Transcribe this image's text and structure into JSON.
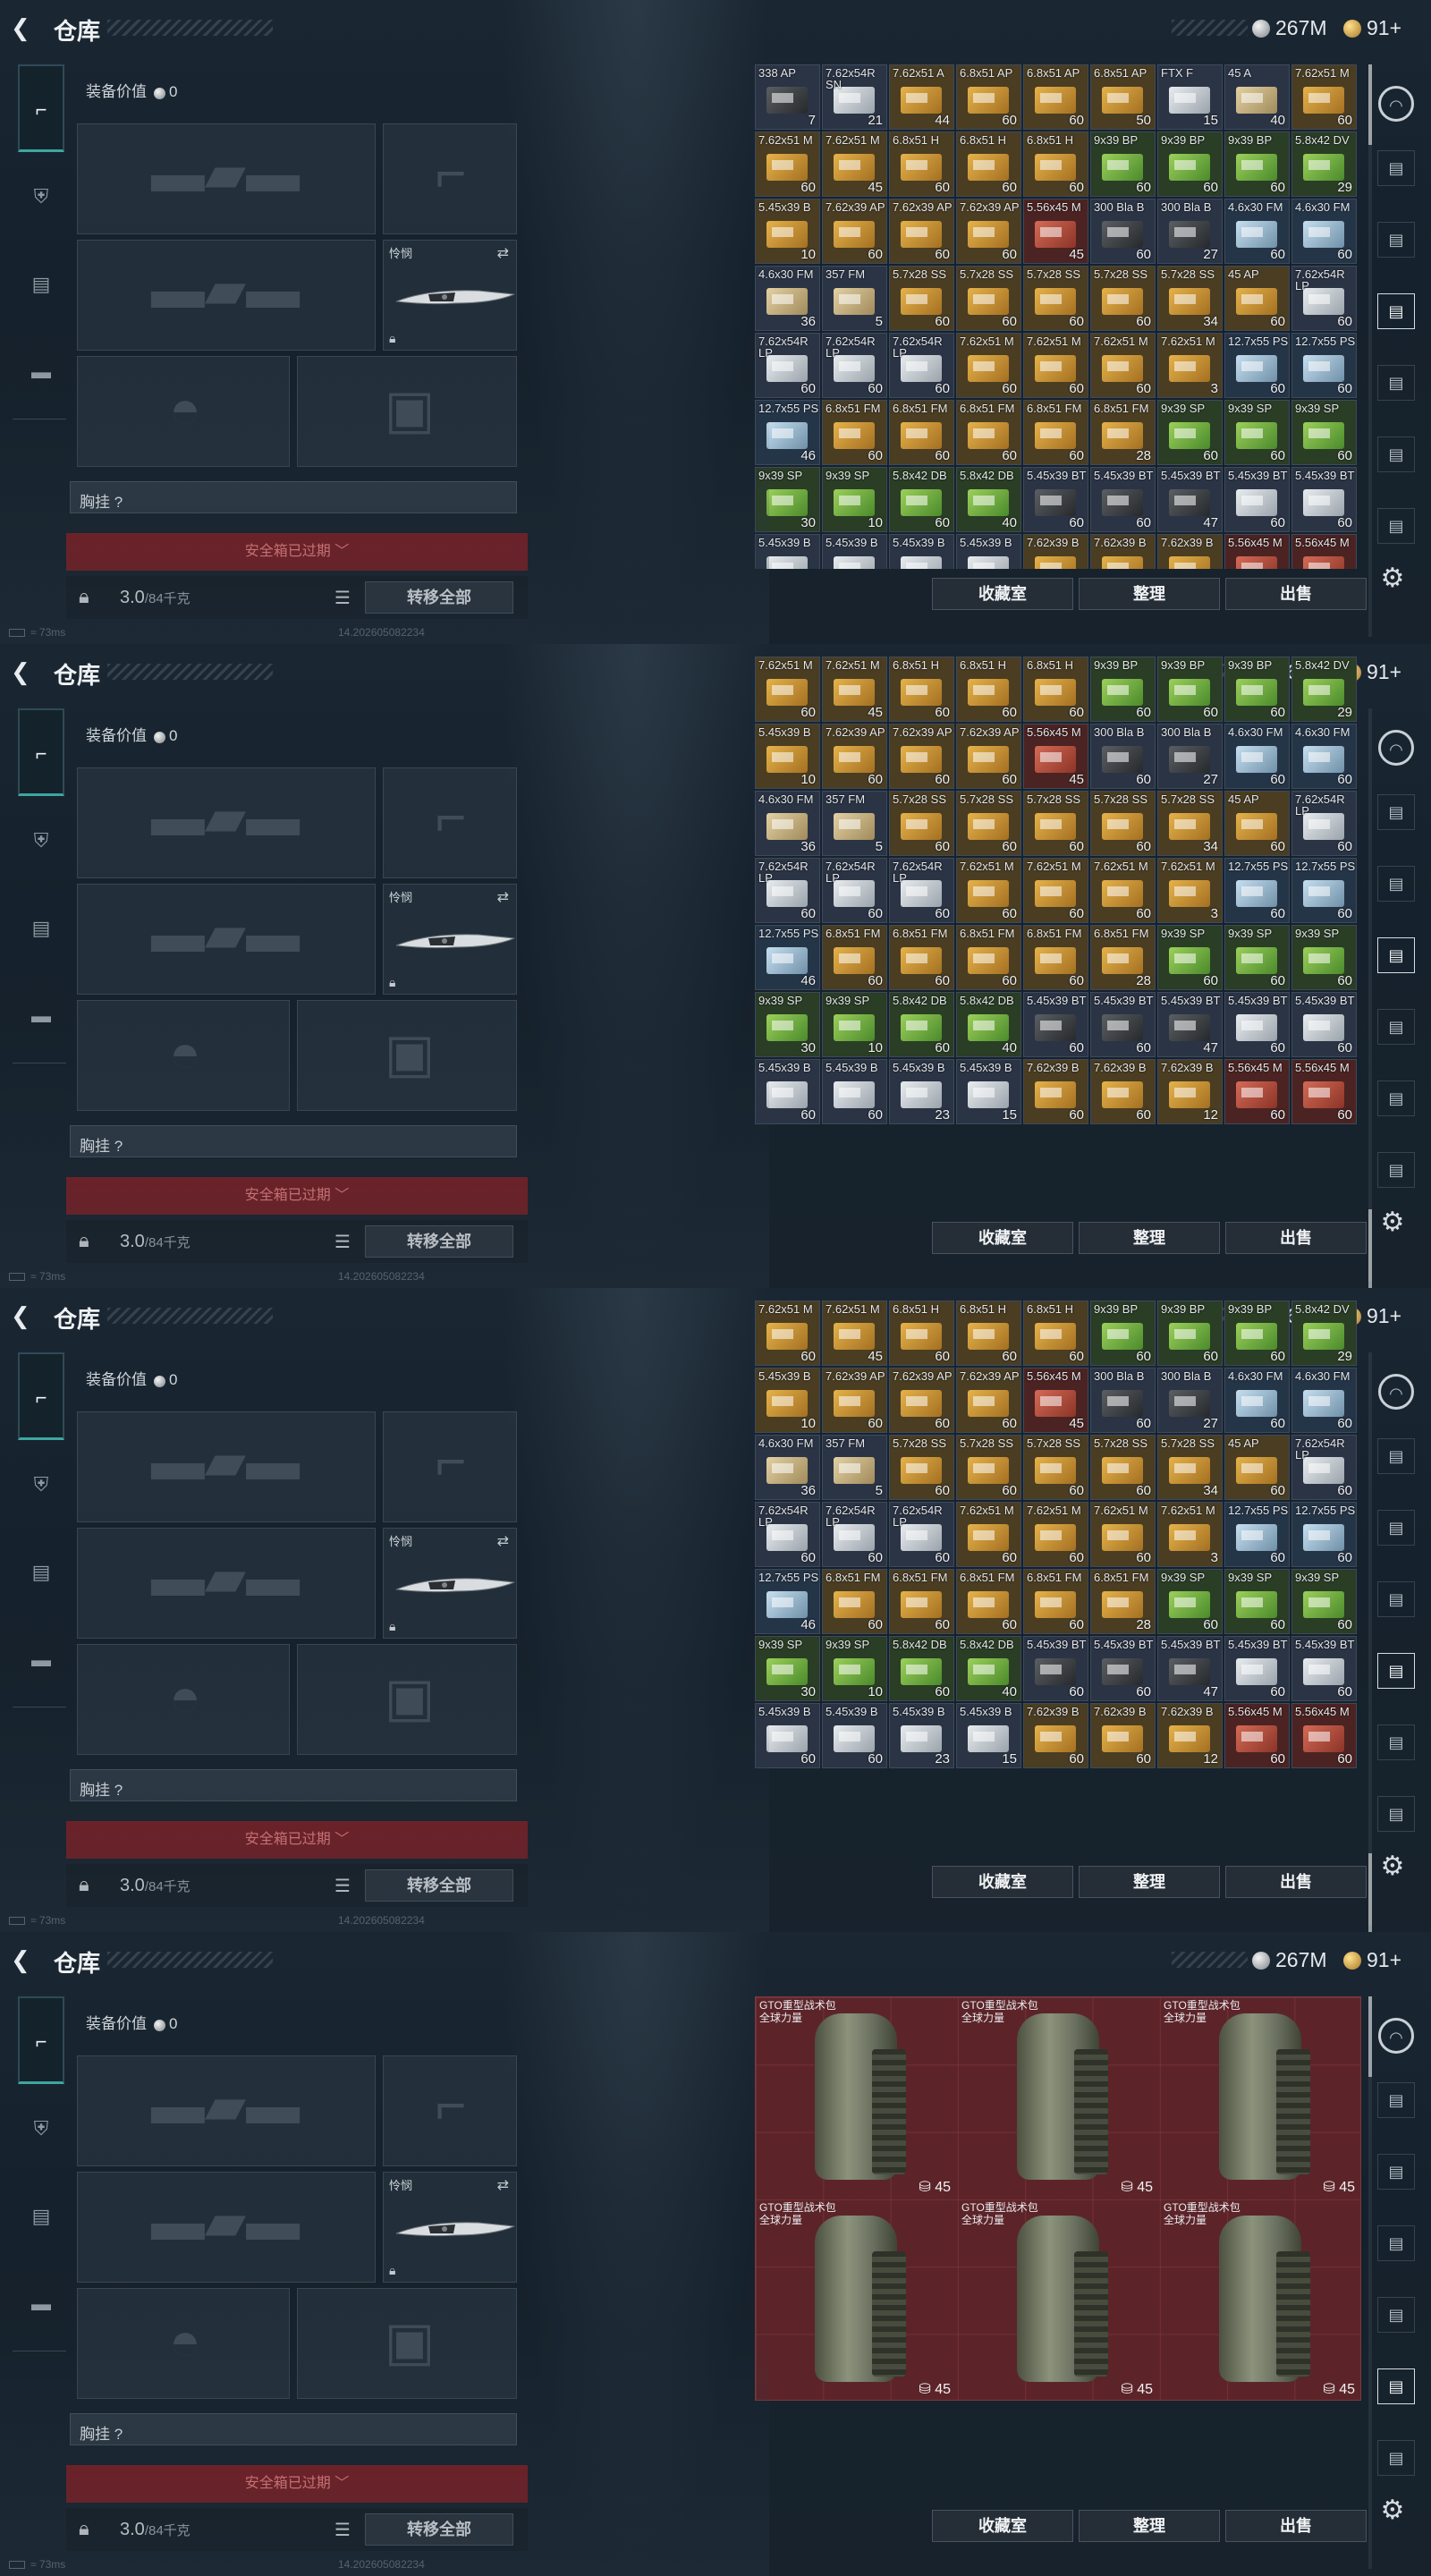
{
  "header": {
    "title": "仓库",
    "silver": "267M",
    "gold": "91+"
  },
  "equip": {
    "value_label": "装备价值",
    "value": "0",
    "melee_label": "怜悯",
    "chest_label": "胸挂 ?",
    "safe_box_label": "安全箱已过期 ﹀",
    "weight": "3.0",
    "weight_max": "/84千克",
    "transfer_all": "转移全部"
  },
  "status": {
    "ping": "73ms",
    "build": "14.202605082234"
  },
  "actions": {
    "favorites": "收藏室",
    "sort": "整理",
    "sell": "出售"
  },
  "panels": [
    {
      "rows": [
        [
          [
            "338 AP",
            "7",
            "dark"
          ],
          [
            "7.62x54R SN",
            "21",
            "white"
          ],
          [
            "7.62x51 A",
            "44",
            "gold"
          ],
          [
            "6.8x51 AP",
            "60",
            "gold"
          ],
          [
            "6.8x51 AP",
            "60",
            "gold"
          ],
          [
            "6.8x51 AP",
            "50",
            "gold"
          ],
          [
            "FTX F",
            "15",
            "white"
          ],
          [
            "45 A",
            "40",
            "beige"
          ],
          [
            "7.62x51 M",
            "60",
            "gold"
          ]
        ],
        [
          [
            "7.62x51 M",
            "60",
            "gold"
          ],
          [
            "7.62x51 M",
            "45",
            "gold"
          ],
          [
            "6.8x51 H",
            "60",
            "gold"
          ],
          [
            "6.8x51 H",
            "60",
            "gold"
          ],
          [
            "6.8x51 H",
            "60",
            "gold"
          ],
          [
            "9x39 BP",
            "60",
            "green"
          ],
          [
            "9x39 BP",
            "60",
            "green"
          ],
          [
            "9x39 BP",
            "60",
            "green"
          ],
          [
            "5.8x42 DV",
            "29",
            "green"
          ]
        ],
        [
          [
            "5.45x39 B",
            "10",
            "gold"
          ],
          [
            "7.62x39 AP",
            "60",
            "gold"
          ],
          [
            "7.62x39 AP",
            "60",
            "gold"
          ],
          [
            "7.62x39 AP",
            "60",
            "gold"
          ],
          [
            "5.56x45 M",
            "45",
            "red"
          ],
          [
            "300 Bla B",
            "60",
            "dark"
          ],
          [
            "300 Bla B",
            "27",
            "dark"
          ],
          [
            "4.6x30 FM",
            "60",
            "blue"
          ],
          [
            "4.6x30 FM",
            "60",
            "blue"
          ]
        ],
        [
          [
            "4.6x30 FM",
            "36",
            "beige"
          ],
          [
            "357 FM",
            "5",
            "beige"
          ],
          [
            "5.7x28 SS",
            "60",
            "gold"
          ],
          [
            "5.7x28 SS",
            "60",
            "gold"
          ],
          [
            "5.7x28 SS",
            "60",
            "gold"
          ],
          [
            "5.7x28 SS",
            "60",
            "gold"
          ],
          [
            "5.7x28 SS",
            "34",
            "gold"
          ],
          [
            "45 AP",
            "60",
            "gold"
          ],
          [
            "7.62x54R LP",
            "60",
            "white"
          ]
        ],
        [
          [
            "7.62x54R LP",
            "60",
            "white"
          ],
          [
            "7.62x54R LP",
            "60",
            "white"
          ],
          [
            "7.62x54R LP",
            "60",
            "white"
          ],
          [
            "7.62x51 M",
            "60",
            "gold"
          ],
          [
            "7.62x51 M",
            "60",
            "gold"
          ],
          [
            "7.62x51 M",
            "60",
            "gold"
          ],
          [
            "7.62x51 M",
            "3",
            "gold"
          ],
          [
            "12.7x55 PS",
            "60",
            "blue"
          ],
          [
            "12.7x55 PS",
            "60",
            "blue"
          ]
        ],
        [
          [
            "12.7x55 PS",
            "46",
            "blue"
          ],
          [
            "6.8x51 FM",
            "60",
            "gold"
          ],
          [
            "6.8x51 FM",
            "60",
            "gold"
          ],
          [
            "6.8x51 FM",
            "60",
            "gold"
          ],
          [
            "6.8x51 FM",
            "60",
            "gold"
          ],
          [
            "6.8x51 FM",
            "28",
            "gold"
          ],
          [
            "9x39 SP",
            "60",
            "green"
          ],
          [
            "9x39 SP",
            "60",
            "green"
          ],
          [
            "9x39 SP",
            "60",
            "green"
          ]
        ],
        [
          [
            "9x39 SP",
            "30",
            "green"
          ],
          [
            "9x39 SP",
            "10",
            "green"
          ],
          [
            "5.8x42 DB",
            "60",
            "green"
          ],
          [
            "5.8x42 DB",
            "40",
            "green"
          ],
          [
            "5.45x39 BT",
            "60",
            "dark"
          ],
          [
            "5.45x39 BT",
            "60",
            "dark"
          ],
          [
            "5.45x39 BT",
            "47",
            "dark"
          ],
          [
            "5.45x39 BT",
            "60",
            "white"
          ],
          [
            "5.45x39 BT",
            "60",
            "white"
          ]
        ],
        [
          [
            "5.45x39 B",
            "60",
            "white"
          ],
          [
            "5.45x39 B",
            "60",
            "white"
          ],
          [
            "5.45x39 B",
            "23",
            "white"
          ],
          [
            "5.45x39 B",
            "15",
            "white"
          ],
          [
            "7.62x39 B",
            "60",
            "gold"
          ],
          [
            "7.62x39 B",
            "60",
            "gold"
          ],
          [
            "7.62x39 B",
            "12",
            "gold"
          ],
          [
            "5.56x45 M",
            "60",
            "red"
          ],
          [
            "5.56x45 M",
            "60",
            "red"
          ]
        ]
      ]
    }
  ],
  "bags": {
    "name_line1": "GTO重型战术包",
    "name_line2": "全球力量",
    "count": "45"
  }
}
